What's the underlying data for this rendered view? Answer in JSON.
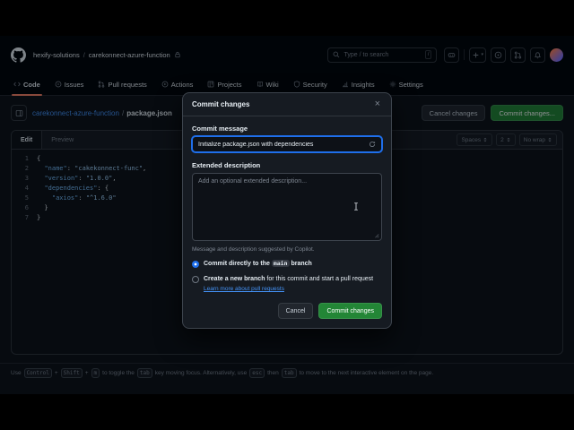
{
  "header": {
    "org": "hexify-solutions",
    "sep": "/",
    "repo": "carekonnect-azure-function",
    "search_placeholder": "Type / to search",
    "slash_key": "/"
  },
  "nav": {
    "items": [
      {
        "label": "Code"
      },
      {
        "label": "Issues"
      },
      {
        "label": "Pull requests"
      },
      {
        "label": "Actions"
      },
      {
        "label": "Projects"
      },
      {
        "label": "Wiki"
      },
      {
        "label": "Security"
      },
      {
        "label": "Insights"
      },
      {
        "label": "Settings"
      }
    ]
  },
  "filebar": {
    "repo": "carekonnect-azure-function",
    "sep": "/",
    "file": "package.json",
    "cancel_button": "Cancel changes",
    "commit_button": "Commit changes..."
  },
  "editor": {
    "tab_edit": "Edit",
    "tab_preview": "Preview",
    "indent_mode": "Spaces",
    "indent_size": "2",
    "wrap": "No wrap",
    "lines": [
      {
        "n": "1",
        "pre": "{",
        "key": "",
        "sep": "",
        "val": "",
        "tail": ""
      },
      {
        "n": "2",
        "pre": "  ",
        "key": "\"name\"",
        "sep": ": ",
        "val": "\"cakekonnect-func\"",
        "tail": ","
      },
      {
        "n": "3",
        "pre": "  ",
        "key": "\"version\"",
        "sep": ": ",
        "val": "\"1.0.0\"",
        "tail": ","
      },
      {
        "n": "4",
        "pre": "  ",
        "key": "\"dependencies\"",
        "sep": ": ",
        "val": "",
        "tail": "{"
      },
      {
        "n": "5",
        "pre": "    ",
        "key": "\"axios\"",
        "sep": ": ",
        "val": "\"^1.6.0\"",
        "tail": ""
      },
      {
        "n": "6",
        "pre": "  }",
        "key": "",
        "sep": "",
        "val": "",
        "tail": ""
      },
      {
        "n": "7",
        "pre": "}",
        "key": "",
        "sep": "",
        "val": "",
        "tail": ""
      }
    ]
  },
  "modal": {
    "title": "Commit changes",
    "close": "×",
    "message_label": "Commit message",
    "message_value": "Initialize package.json with dependencies",
    "description_label": "Extended description",
    "description_placeholder": "Add an optional extended description...",
    "copilot_note": "Message and description suggested by Copilot.",
    "radio_direct_pre": "Commit directly to the ",
    "radio_direct_branch": "main",
    "radio_direct_post": " branch",
    "radio_branch_pre": "Create a ",
    "radio_branch_bold": "new branch",
    "radio_branch_post": " for this commit and start a pull request",
    "learn_more": "Learn more about pull requests",
    "cancel_button": "Cancel",
    "commit_button": "Commit changes"
  },
  "footer": {
    "t1": "Use",
    "k1": "Control",
    "p1": "+",
    "k2": "Shift",
    "p2": "+",
    "k3": "m",
    "t2": "to toggle the",
    "k4": "tab",
    "t3": "key moving focus. Alternatively, use",
    "k5": "esc",
    "t4": "then",
    "k6": "tab",
    "t5": "to move to the next interactive element on the page."
  },
  "colors": {
    "accent_green": "#238636",
    "link_blue": "#4493f8",
    "focus_blue": "#1f6feb",
    "tab_underline": "#f78166"
  }
}
